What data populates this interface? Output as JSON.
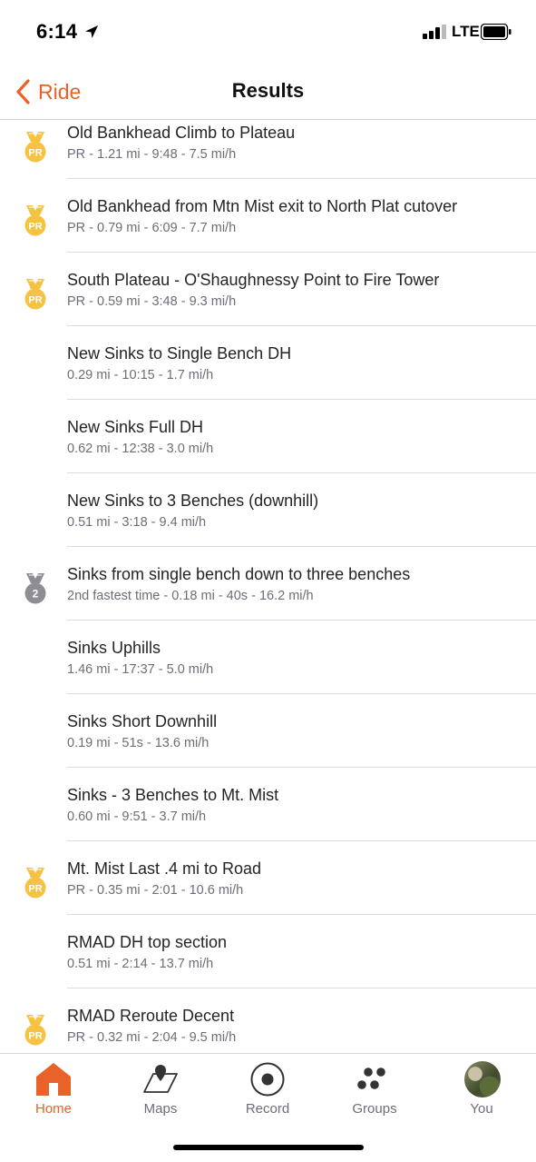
{
  "status_bar": {
    "time": "6:14",
    "network": "LTE"
  },
  "nav": {
    "back_label": "Ride",
    "title": "Results"
  },
  "segments": [
    {
      "name": "Old Bankhead Climb to Plateau",
      "stats": "PR - 1.21 mi - 9:48 - 7.5 mi/h",
      "badge": "PR"
    },
    {
      "name": "Old Bankhead from Mtn Mist exit to North Plat cutover",
      "stats": "PR - 0.79 mi - 6:09 - 7.7 mi/h",
      "badge": "PR"
    },
    {
      "name": "South Plateau - O'Shaughnessy Point to Fire Tower",
      "stats": "PR - 0.59 mi - 3:48 - 9.3 mi/h",
      "badge": "PR"
    },
    {
      "name": "New Sinks to Single Bench DH",
      "stats": "0.29 mi - 10:15 - 1.7 mi/h",
      "badge": ""
    },
    {
      "name": "New Sinks Full DH",
      "stats": "0.62 mi - 12:38 - 3.0 mi/h",
      "badge": ""
    },
    {
      "name": "New Sinks to 3 Benches (downhill)",
      "stats": "0.51 mi - 3:18 - 9.4 mi/h",
      "badge": ""
    },
    {
      "name": "Sinks from single bench down to three benches",
      "stats": "2nd fastest time - 0.18 mi - 40s - 16.2 mi/h",
      "badge": "2"
    },
    {
      "name": "Sinks Uphills",
      "stats": "1.46 mi - 17:37 - 5.0 mi/h",
      "badge": ""
    },
    {
      "name": "Sinks Short Downhill",
      "stats": "0.19 mi - 51s - 13.6 mi/h",
      "badge": ""
    },
    {
      "name": "Sinks - 3 Benches to Mt. Mist",
      "stats": "0.60 mi - 9:51 - 3.7 mi/h",
      "badge": ""
    },
    {
      "name": "Mt. Mist Last .4 mi to Road",
      "stats": "PR - 0.35 mi - 2:01 - 10.6 mi/h",
      "badge": "PR"
    },
    {
      "name": "RMAD DH top section",
      "stats": "0.51 mi - 2:14 - 13.7 mi/h",
      "badge": ""
    },
    {
      "name": "RMAD Reroute Decent",
      "stats": "PR - 0.32 mi - 2:04 - 9.5 mi/h",
      "badge": "PR"
    }
  ],
  "tabs": [
    {
      "label": "Home",
      "icon": "home-icon",
      "active": true
    },
    {
      "label": "Maps",
      "icon": "maps-icon",
      "active": false
    },
    {
      "label": "Record",
      "icon": "record-icon",
      "active": false
    },
    {
      "label": "Groups",
      "icon": "groups-icon",
      "active": false
    },
    {
      "label": "You",
      "icon": "avatar",
      "active": false
    }
  ],
  "colors": {
    "accent": "#e8622a",
    "medal_gold": "#f5c242",
    "medal_silver": "#8d8d93",
    "text_secondary": "#6d6d78"
  }
}
